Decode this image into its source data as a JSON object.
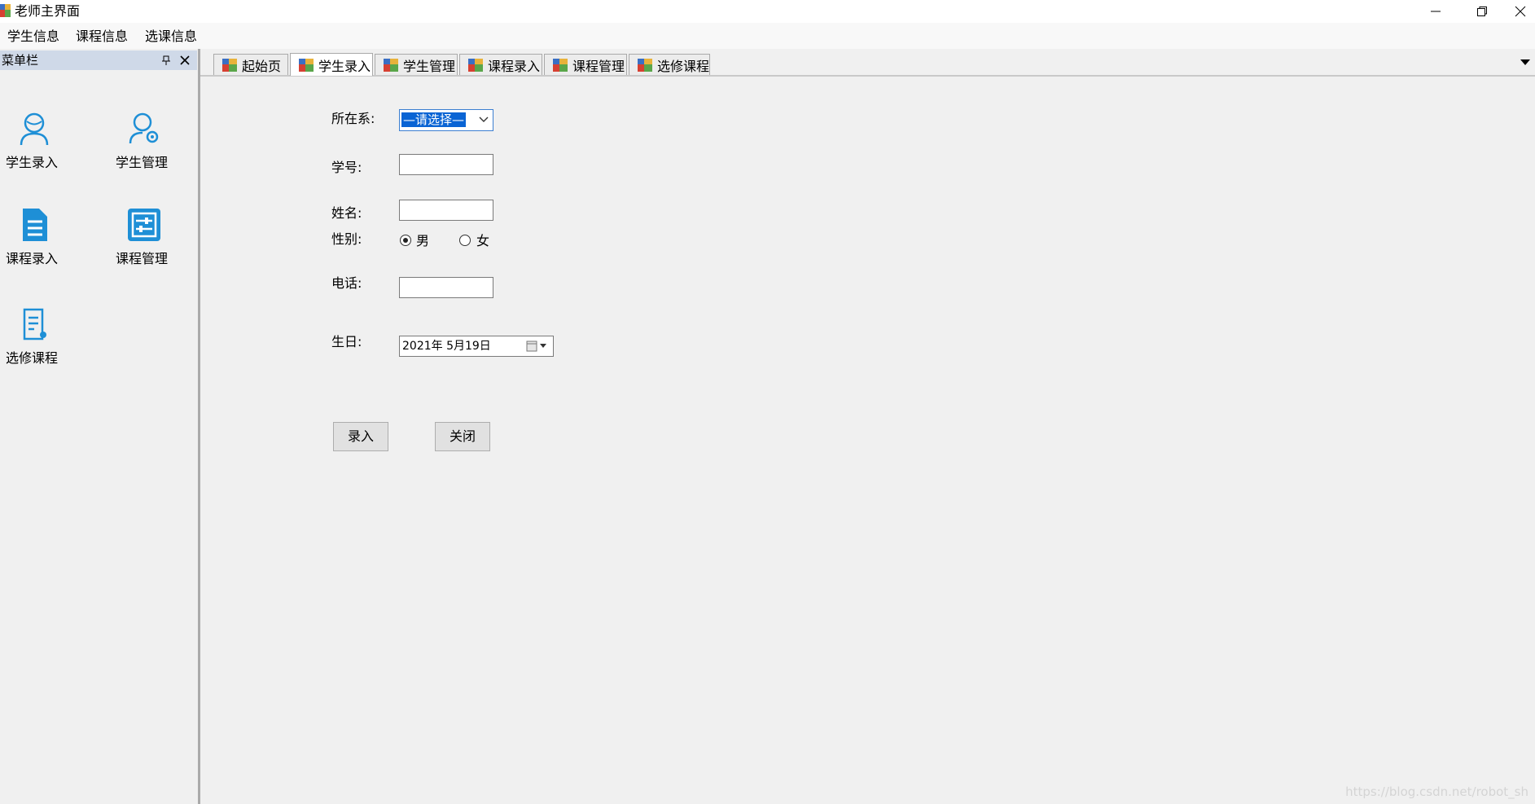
{
  "window": {
    "title": "老师主界面"
  },
  "menu": {
    "items": [
      "学生信息",
      "课程信息",
      "选课信息"
    ]
  },
  "dock": {
    "title": "菜单栏",
    "items": [
      {
        "label": "学生录入",
        "icon": "user-icon"
      },
      {
        "label": "学生管理",
        "icon": "user-settings-icon"
      },
      {
        "label": "课程录入",
        "icon": "document-icon"
      },
      {
        "label": "课程管理",
        "icon": "sliders-icon"
      },
      {
        "label": "选修课程",
        "icon": "document-settings-icon"
      }
    ]
  },
  "tabs": [
    {
      "label": "起始页",
      "active": false
    },
    {
      "label": "学生录入",
      "active": true
    },
    {
      "label": "学生管理",
      "active": false
    },
    {
      "label": "课程录入",
      "active": false
    },
    {
      "label": "课程管理",
      "active": false
    },
    {
      "label": "选修课程",
      "active": false
    }
  ],
  "form": {
    "dept_label": "所在系:",
    "dept_value": "—请选择—",
    "id_label": "学号:",
    "id_value": "",
    "name_label": "姓名:",
    "name_value": "",
    "gender_label": "性别:",
    "gender_male": "男",
    "gender_female": "女",
    "gender_selected": "男",
    "phone_label": "电话:",
    "phone_value": "",
    "birthday_label": "生日:",
    "birthday_value": "2021年  5月19日",
    "submit_button": "录入",
    "close_button": "关闭"
  },
  "watermark": "https://blog.csdn.net/robot_sh",
  "colors": {
    "accent": "#1e8fd6",
    "selection": "#0a64d4",
    "dock_header": "#cfd9e8"
  }
}
